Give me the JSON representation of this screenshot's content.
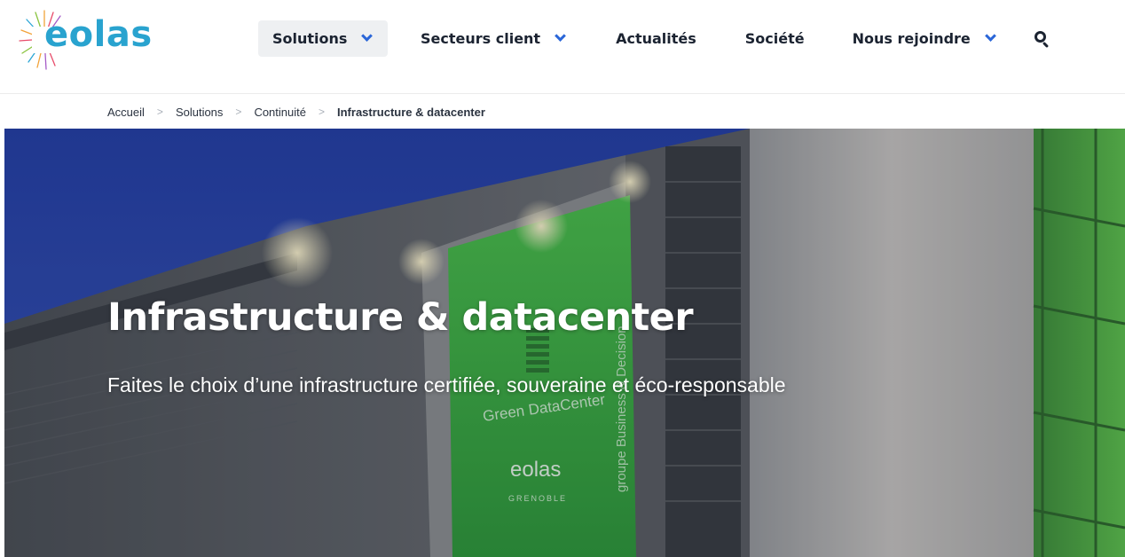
{
  "header": {
    "logo_text": "eolas"
  },
  "nav": {
    "items": [
      {
        "label": "Solutions",
        "has_dropdown": true,
        "active": true
      },
      {
        "label": "Secteurs client",
        "has_dropdown": true
      },
      {
        "label": "Actualités",
        "has_dropdown": false
      },
      {
        "label": "Société",
        "has_dropdown": false
      },
      {
        "label": "Nous rejoindre",
        "has_dropdown": true
      }
    ],
    "search_icon": "search-icon"
  },
  "breadcrumb": {
    "items": [
      "Accueil",
      "Solutions",
      "Continuité"
    ],
    "current": "Infrastructure & datacenter",
    "separator": ">"
  },
  "hero": {
    "title": "Infrastructure & datacenter",
    "subtitle": "Faites le choix d’une infrastructure certifiée, souveraine et éco-responsable",
    "image_text": {
      "banner_main": "Green DataCenter",
      "banner_brand": "eolas",
      "banner_city": "GRENOBLE",
      "banner_side": "groupe Business & Decision"
    }
  },
  "colors": {
    "logo_blue": "#29a3cf",
    "chevron_blue": "#2a66d8",
    "nav_text": "#1b2331",
    "active_bg": "#eef0f2",
    "green_banner": "#3fae45"
  }
}
